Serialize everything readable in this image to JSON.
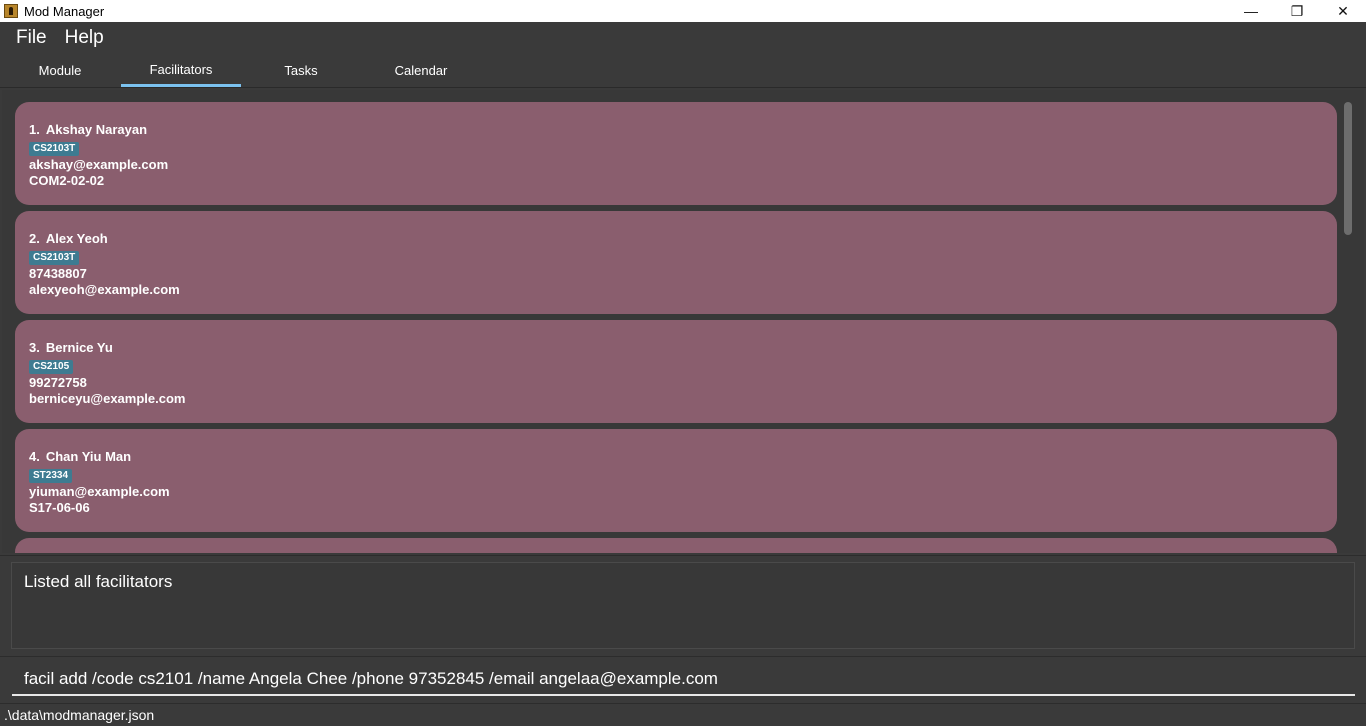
{
  "window": {
    "title": "Mod Manager",
    "minimize_glyph": "—",
    "restore_glyph": "❐",
    "close_glyph": "✕"
  },
  "menu": {
    "file": "File",
    "help": "Help"
  },
  "tabs": [
    {
      "label": "Module",
      "active": false
    },
    {
      "label": "Facilitators",
      "active": true
    },
    {
      "label": "Tasks",
      "active": false
    },
    {
      "label": "Calendar",
      "active": false
    }
  ],
  "facilitators": [
    {
      "index": "1.",
      "name": "Akshay Narayan",
      "tag": "CS2103T",
      "line1": "akshay@example.com",
      "line2": "COM2-02-02"
    },
    {
      "index": "2.",
      "name": "Alex Yeoh",
      "tag": "CS2103T",
      "line1": "87438807",
      "line2": "alexyeoh@example.com"
    },
    {
      "index": "3.",
      "name": "Bernice Yu",
      "tag": "CS2105",
      "line1": "99272758",
      "line2": "berniceyu@example.com"
    },
    {
      "index": "4.",
      "name": "Chan Yiu Man",
      "tag": "ST2334",
      "line1": "yiuman@example.com",
      "line2": "S17-06-06"
    }
  ],
  "result": {
    "message": "Listed all facilitators"
  },
  "command": {
    "value": "facil add /code cs2101 /name Angela Chee /phone 97352845 /email angelaa@example.com"
  },
  "status": {
    "path": ".\\data\\modmanager.json"
  },
  "colors": {
    "background": "#3a3a3a",
    "card": "#8a5e6e",
    "tag": "#3e7b91",
    "tab_indicator": "#7cc3f0"
  }
}
